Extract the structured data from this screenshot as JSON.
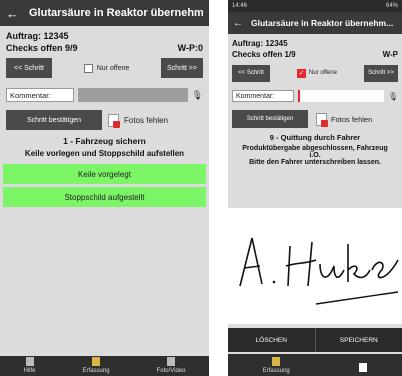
{
  "left": {
    "title": "Glutarsäure in Reaktor übernehm...",
    "auftrag": "Auftrag: 12345",
    "checks": "Checks offen 9/9",
    "wp": "W-P:0",
    "prev_btn": "<< Schritt",
    "nur_offene": "Nur offene",
    "next_btn": "Schritt >>",
    "kommentar": "Kommentar:",
    "confirm_btn": "Schritt bestätigen",
    "fotos": "Fotos fehlen",
    "step_title": "1 - Fahrzeug sichern",
    "step_desc": "Keile vorlegen und Stoppschild aufstellen",
    "action1": "Keile vorgelegt",
    "action2": "Stoppschild aufgestellt",
    "nav": [
      "Hilfe",
      "Erfassung",
      "Foto/Video"
    ]
  },
  "right": {
    "status_time": "14:46",
    "status_right": "64%",
    "title": "Glutarsäure in Reaktor übernehm...",
    "auftrag": "Auftrag: 12345",
    "checks": "Checks offen 1/9",
    "wp": "W-P",
    "prev_btn": "<< Schritt",
    "nur_offene": "Nur offene",
    "next_btn": "Schritt >>",
    "kommentar": "Kommentar:",
    "confirm_btn": "Schritt bestätigen",
    "fotos": "Fotos fehlen",
    "step_title": "9 - Quittung durch Fahrer",
    "step_desc1": "Produktübergabe abgeschlossen, Fahrzeug",
    "step_desc2": "i.O.",
    "step_desc3": "Bitte den Fahrer unterschreiben lassen.",
    "delete_btn": "LÖSCHEN",
    "save_btn": "SPEICHERN",
    "nav": [
      "Erfassung"
    ]
  },
  "colors": {
    "accent_green": "#7cf566",
    "accent_red": "#e0282e",
    "dark_bar": "#3a3a3a"
  }
}
